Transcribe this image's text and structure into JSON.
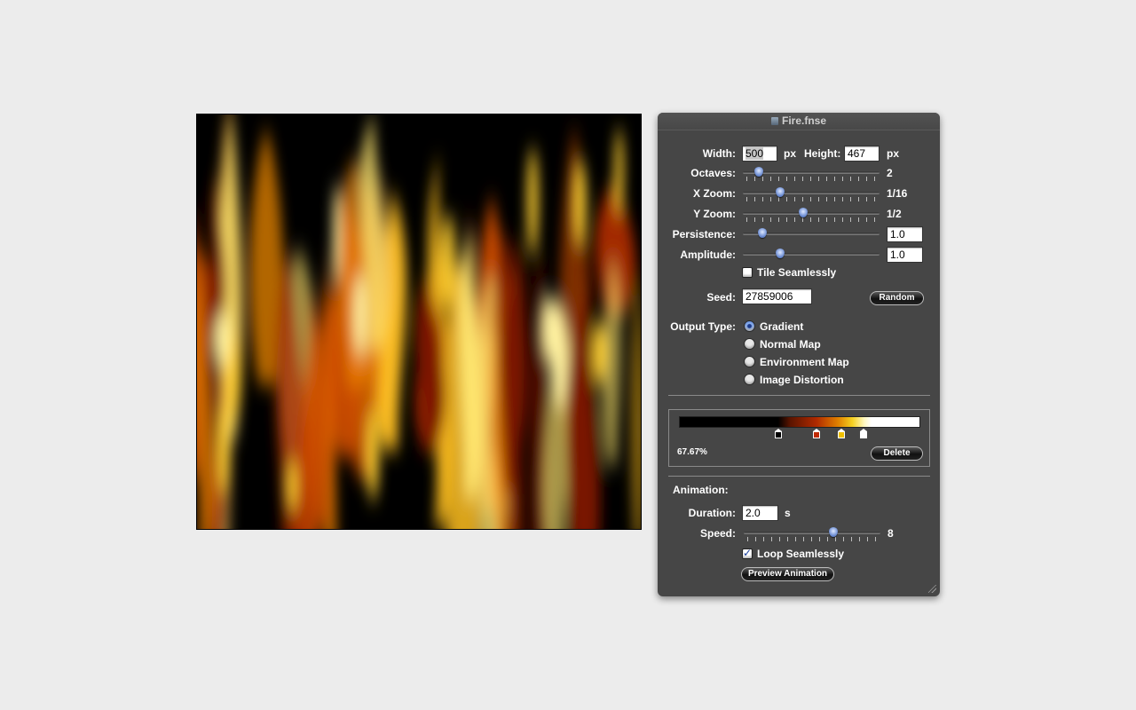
{
  "panel": {
    "title": "Fire.fnse",
    "width_label": "Width:",
    "width_value": "500",
    "width_unit": "px",
    "height_label": "Height:",
    "height_value": "467",
    "height_unit": "px",
    "octaves_label": "Octaves:",
    "octaves_value": "2",
    "octaves_level": 0.09,
    "xzoom_label": "X Zoom:",
    "xzoom_value": "1/16",
    "xzoom_level": 0.26,
    "yzoom_label": "Y Zoom:",
    "yzoom_value": "1/2",
    "yzoom_level": 0.44,
    "persistence_label": "Persistence:",
    "persistence_value": "1.0",
    "persistence_level": 0.12,
    "amplitude_label": "Amplitude:",
    "amplitude_value": "1.0",
    "amplitude_level": 0.26,
    "tile_label": "Tile Seamlessly",
    "tile_checked": false,
    "seed_label": "Seed:",
    "seed_value": "27859006",
    "random_button": "Random",
    "output_type_label": "Output Type:",
    "output_types": [
      {
        "label": "Gradient",
        "selected": true
      },
      {
        "label": "Normal Map",
        "selected": false
      },
      {
        "label": "Environment Map",
        "selected": false
      },
      {
        "label": "Image Distortion",
        "selected": false
      }
    ],
    "gradient": {
      "selected_position": "67.67%",
      "delete_button": "Delete",
      "stops": [
        {
          "pos": 0.415,
          "color": "#000000"
        },
        {
          "pos": 0.575,
          "color": "#c02a00"
        },
        {
          "pos": 0.676,
          "color": "#f0c000"
        },
        {
          "pos": 0.77,
          "color": "#ffffff"
        }
      ]
    },
    "animation_heading": "Animation:",
    "duration_label": "Duration:",
    "duration_value": "2.0",
    "duration_unit": "s",
    "speed_label": "Speed:",
    "speed_value": "8",
    "speed_level": 0.67,
    "loop_label": "Loop Seamlessly",
    "loop_checked": true,
    "preview_button": "Preview Animation"
  },
  "colors": {
    "panel_bg": "#464646",
    "page_bg": "#ececec",
    "fire_dark": "#000000",
    "fire_red": "#c02a00",
    "fire_orange": "#e88000",
    "fire_yellow": "#ffd030",
    "fire_white": "#fff6c0"
  }
}
